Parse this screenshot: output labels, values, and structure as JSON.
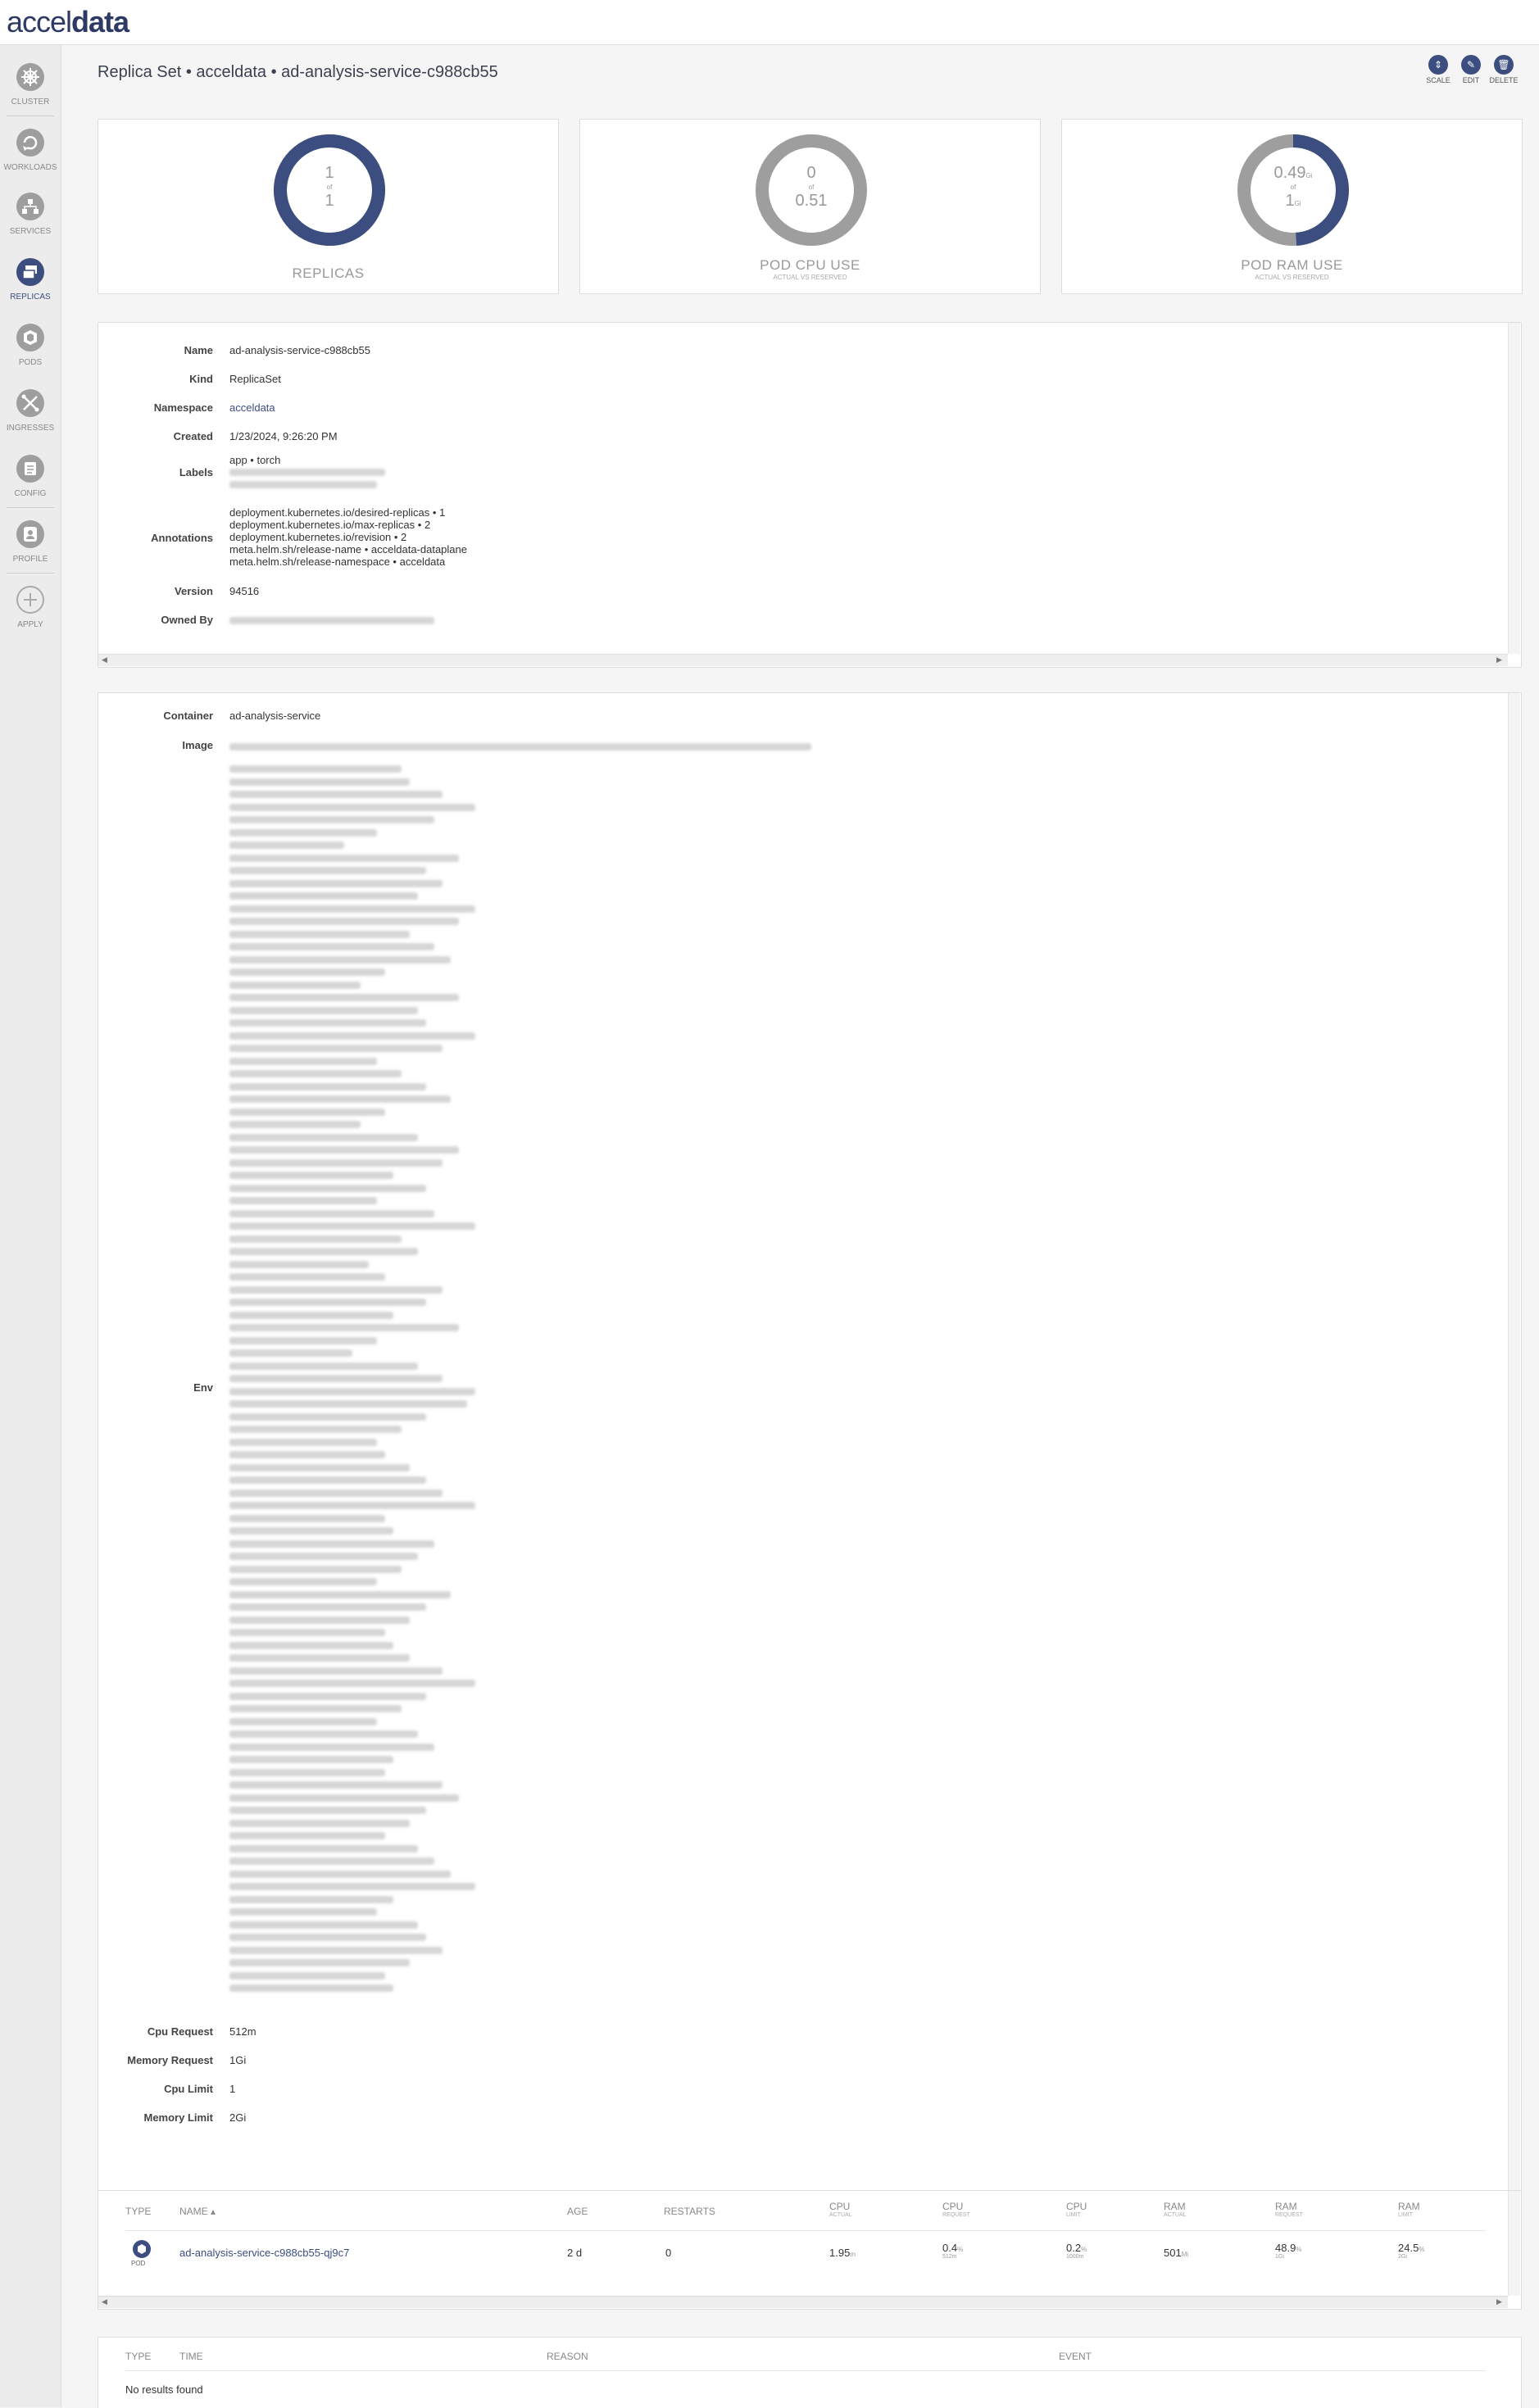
{
  "app": {
    "logo_prefix": "accel",
    "logo_suffix": "data"
  },
  "sidebar": {
    "items": [
      {
        "key": "cluster",
        "label": "CLUSTER",
        "icon": "helm-wheel-icon",
        "active": false
      },
      {
        "key": "workloads",
        "label": "WORKLOADS",
        "icon": "refresh-icon",
        "active": false
      },
      {
        "key": "services",
        "label": "SERVICES",
        "icon": "network-icon",
        "active": false
      },
      {
        "key": "replicas",
        "label": "REPLICAS",
        "icon": "layers-icon",
        "active": true
      },
      {
        "key": "pods",
        "label": "PODS",
        "icon": "cube-icon",
        "active": false
      },
      {
        "key": "ingresses",
        "label": "INGRESSES",
        "icon": "ingress-icon",
        "active": false
      },
      {
        "key": "config",
        "label": "CONFIG",
        "icon": "config-icon",
        "active": false
      },
      {
        "key": "profile",
        "label": "PROFILE",
        "icon": "user-icon",
        "active": false
      },
      {
        "key": "apply",
        "label": "APPLY",
        "icon": "plus-icon",
        "active": false
      }
    ]
  },
  "header": {
    "title": "Replica Set • acceldata • ad-analysis-service-c988cb55",
    "actions": [
      {
        "label": "SCALE",
        "icon": "scale-icon"
      },
      {
        "label": "EDIT",
        "icon": "pencil-icon"
      },
      {
        "label": "DELETE",
        "icon": "trash-icon"
      }
    ]
  },
  "gauges": [
    {
      "label": "REPLICAS",
      "subtitle": "",
      "top": "1",
      "of": "of",
      "bottom": "1",
      "top_unit": "",
      "bottom_unit": "",
      "fill": 1.0
    },
    {
      "label": "POD CPU USE",
      "subtitle": "ACTUAL VS RESERVED",
      "top": "0",
      "of": "of",
      "bottom": "0.51",
      "top_unit": "",
      "bottom_unit": "",
      "fill": 0.0
    },
    {
      "label": "POD RAM USE",
      "subtitle": "ACTUAL VS RESERVED",
      "top": "0.49",
      "of": "of",
      "bottom": "1",
      "top_unit": "Gi",
      "bottom_unit": "Gi",
      "fill": 0.49
    }
  ],
  "colors": {
    "accent": "#3c4d80",
    "gauge_track": "#9e9e9e"
  },
  "details": {
    "name_label": "Name",
    "name": "ad-analysis-service-c988cb55",
    "kind_label": "Kind",
    "kind": "ReplicaSet",
    "namespace_label": "Namespace",
    "namespace": "acceldata",
    "created_label": "Created",
    "created": "1/23/2024, 9:26:20 PM",
    "labels_label": "Labels",
    "labels_first": "app • torch",
    "annotations_label": "Annotations",
    "annotations": [
      "deployment.kubernetes.io/desired-replicas • 1",
      "deployment.kubernetes.io/max-replicas • 2",
      "deployment.kubernetes.io/revision • 2",
      "meta.helm.sh/release-name • acceldata-dataplane",
      "meta.helm.sh/release-namespace • acceldata"
    ],
    "version_label": "Version",
    "version": "94516",
    "owned_by_label": "Owned By"
  },
  "container": {
    "container_label": "Container",
    "container": "ad-analysis-service",
    "image_label": "Image",
    "env_label": "Env",
    "cpu_request_label": "Cpu Request",
    "cpu_request": "512m",
    "memory_request_label": "Memory Request",
    "memory_request": "1Gi",
    "cpu_limit_label": "Cpu Limit",
    "cpu_limit": "1",
    "memory_limit_label": "Memory Limit",
    "memory_limit": "2Gi"
  },
  "pods_table": {
    "headers": {
      "type": "TYPE",
      "name": "NAME",
      "sort": "▴",
      "age": "AGE",
      "restarts": "RESTARTS",
      "cpu_actual": "CPU",
      "cpu_actual_sub": "ACTUAL",
      "cpu_request": "CPU",
      "cpu_request_sub": "REQUEST",
      "cpu_limit": "CPU",
      "cpu_limit_sub": "LIMIT",
      "ram_actual": "RAM",
      "ram_actual_sub": "ACTUAL",
      "ram_request": "RAM",
      "ram_request_sub": "REQUEST",
      "ram_limit": "RAM",
      "ram_limit_sub": "LIMIT"
    },
    "rows": [
      {
        "type": "POD",
        "name": "ad-analysis-service-c988cb55-qj9c7",
        "age": "2 d",
        "restarts": "0",
        "cpu_actual": "1.95",
        "cpu_actual_unit": "m",
        "cpu_request": "0.4",
        "cpu_request_unit": "%",
        "cpu_request_sub": "512m",
        "cpu_limit": "0.2",
        "cpu_limit_unit": "%",
        "cpu_limit_sub": "1000m",
        "ram_actual": "501",
        "ram_actual_unit": "Mi",
        "ram_request": "48.9",
        "ram_request_unit": "%",
        "ram_request_sub": "1Gi",
        "ram_limit": "24.5",
        "ram_limit_unit": "%",
        "ram_limit_sub": "2Gi"
      }
    ]
  },
  "events_table": {
    "headers": {
      "type": "TYPE",
      "time": "TIME",
      "reason": "REASON",
      "event": "EVENT"
    },
    "empty": "No results found"
  }
}
